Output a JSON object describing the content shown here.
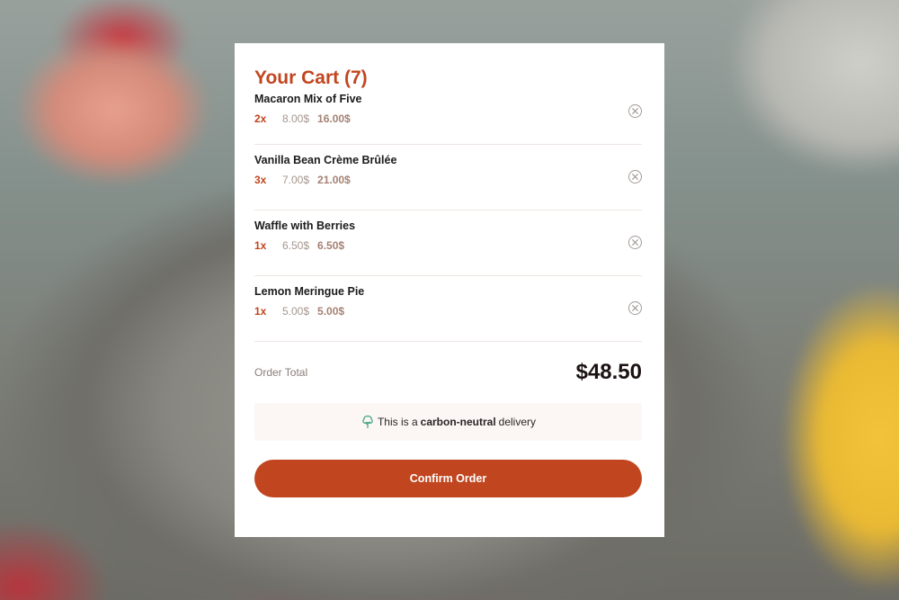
{
  "cart": {
    "title": "Your Cart (7)",
    "items": [
      {
        "name": "Macaron Mix of Five",
        "qty": "2x",
        "unit_price": "8.00$",
        "subtotal": "16.00$"
      },
      {
        "name": "Vanilla Bean Crème Brûlée",
        "qty": "3x",
        "unit_price": "7.00$",
        "subtotal": "21.00$"
      },
      {
        "name": "Waffle with Berries",
        "qty": "1x",
        "unit_price": "6.50$",
        "subtotal": "6.50$"
      },
      {
        "name": "Lemon Meringue Pie",
        "qty": "1x",
        "unit_price": "5.00$",
        "subtotal": "5.00$"
      }
    ],
    "remove_icon": "remove-circle-x-icon",
    "order_total_label": "Order Total",
    "order_total_value": "$48.50",
    "carbon_notice": {
      "icon": "tree-icon",
      "prefix": "This is a",
      "emphasis": "carbon-neutral",
      "suffix": "delivery"
    },
    "confirm_label": "Confirm Order"
  },
  "colors": {
    "accent": "#c1461f",
    "card_bg": "#ffffff",
    "notice_bg": "#fcf7f4",
    "tree_icon": "#3aa37f"
  }
}
